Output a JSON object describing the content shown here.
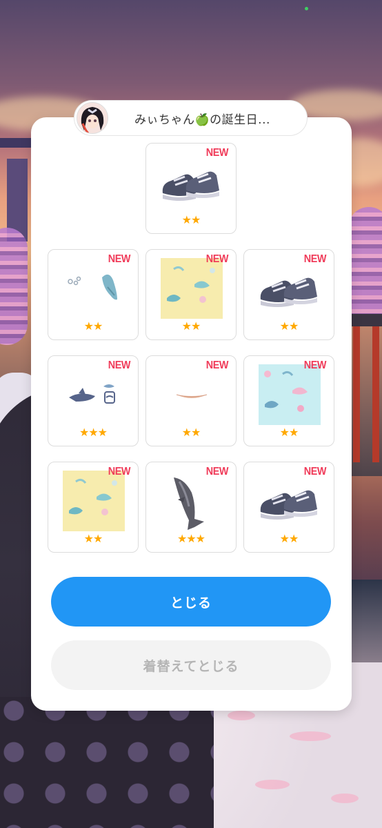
{
  "header": {
    "title": "みぃちゃん🍏の誕生日..."
  },
  "grid": {
    "items": [
      {
        "name": "sneakers",
        "badge": "NEW",
        "stars": "★★"
      },
      {
        "name": "shark-bubbles",
        "badge": "NEW",
        "stars": "★★"
      },
      {
        "name": "yellow-shark-fabric",
        "badge": "NEW",
        "stars": "★★"
      },
      {
        "name": "sneakers",
        "badge": "NEW",
        "stars": "★★"
      },
      {
        "name": "shark-accessories",
        "badge": "NEW",
        "stars": "★★★"
      },
      {
        "name": "lip-gloss",
        "badge": "NEW",
        "stars": "★★"
      },
      {
        "name": "blue-shark-fabric",
        "badge": "NEW",
        "stars": "★★"
      },
      {
        "name": "yellow-shark-fabric",
        "badge": "NEW",
        "stars": "★★"
      },
      {
        "name": "shark-plush",
        "badge": "NEW",
        "stars": "★★★"
      },
      {
        "name": "sneakers",
        "badge": "NEW",
        "stars": "★★"
      }
    ]
  },
  "buttons": {
    "close_label": "とじる",
    "change_close_label": "着替えてとじる"
  },
  "colors": {
    "primary": "#2196f5",
    "new_badge": "#f03c5a",
    "star": "#ffa800",
    "disabled_text": "#b5b5b5"
  }
}
